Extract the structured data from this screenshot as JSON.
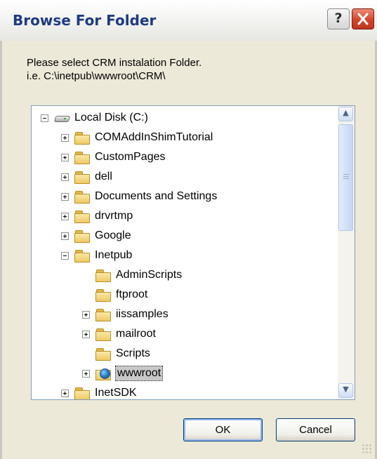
{
  "window": {
    "title": "Browse For Folder",
    "help_label": "?"
  },
  "prompt": {
    "line1": "Please select CRM instalation Folder.",
    "line2": "i.e. C:\\inetpub\\wwwroot\\CRM\\"
  },
  "tree": {
    "root": "Local Disk (C:)",
    "items": [
      "COMAddInShimTutorial",
      "CustomPages",
      "dell",
      "Documents and Settings",
      "drvrtmp",
      "Google",
      "Inetpub",
      "AdminScripts",
      "ftproot",
      "iissamples",
      "mailroot",
      "Scripts",
      "wwwroot",
      "InetSDK"
    ],
    "selected": "wwwroot"
  },
  "scrollbar": {
    "up_glyph": "▲",
    "down_glyph": "▼"
  },
  "buttons": {
    "ok": "OK",
    "cancel": "Cancel"
  }
}
